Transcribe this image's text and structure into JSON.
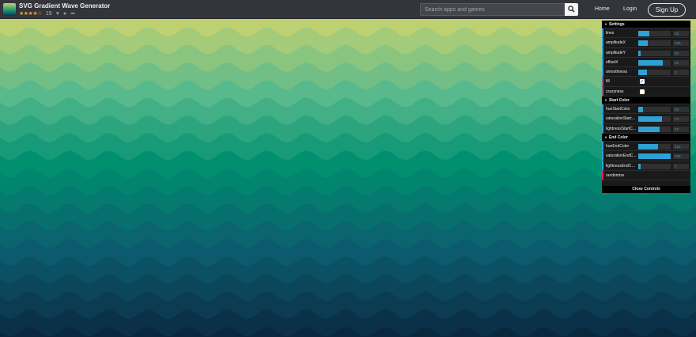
{
  "header": {
    "app_title": "SVG Gradient Wave Generator",
    "stars": "★★★★☆",
    "rating_count": "15",
    "icons": [
      "heart-icon",
      "info-icon",
      "share-icon"
    ],
    "search_placeholder": "Search apps and games",
    "nav": {
      "home": "Home",
      "login": "Login",
      "signup": "Sign Up"
    }
  },
  "canvas": {
    "description_colors": {
      "top": "#d6d76c",
      "upper_mid": "#58b98d",
      "mid": "#00906f",
      "lower": "#0a5a6e",
      "bottom": "#091d33"
    }
  },
  "controls": {
    "settings_title": "Settings",
    "settings": [
      {
        "label": "lines",
        "type": "number",
        "value": "20",
        "fill": 0.33
      },
      {
        "label": "amplitudeX",
        "type": "number",
        "value": "100",
        "fill": 0.3
      },
      {
        "label": "amplitudeY",
        "type": "number",
        "value": "20",
        "fill": 0.08
      },
      {
        "label": "offsetX",
        "type": "number",
        "value": "10",
        "fill": 0.75
      },
      {
        "label": "smoothness",
        "type": "number",
        "value": "3",
        "fill": 0.27
      },
      {
        "label": "fill",
        "type": "boolean",
        "checked": true
      },
      {
        "label": "crazyness",
        "type": "boolean",
        "checked": false
      }
    ],
    "start_title": "Start Color",
    "start": [
      {
        "label": "hueStartColor",
        "type": "number",
        "value": "53",
        "fill": 0.15
      },
      {
        "label": "saturationStartC...",
        "type": "number",
        "value": "74",
        "fill": 0.74
      },
      {
        "label": "lightnessStartC...",
        "type": "number",
        "value": "67",
        "fill": 0.67
      }
    ],
    "end_title": "End Color",
    "end": [
      {
        "label": "hueEndColor",
        "type": "number",
        "value": "216",
        "fill": 0.6
      },
      {
        "label": "saturationEndC...",
        "type": "number",
        "value": "100",
        "fill": 1.0
      },
      {
        "label": "lightnessEndColor",
        "type": "number",
        "value": "7",
        "fill": 0.07
      }
    ],
    "randomize": "randomize",
    "close": "Close Controls"
  }
}
